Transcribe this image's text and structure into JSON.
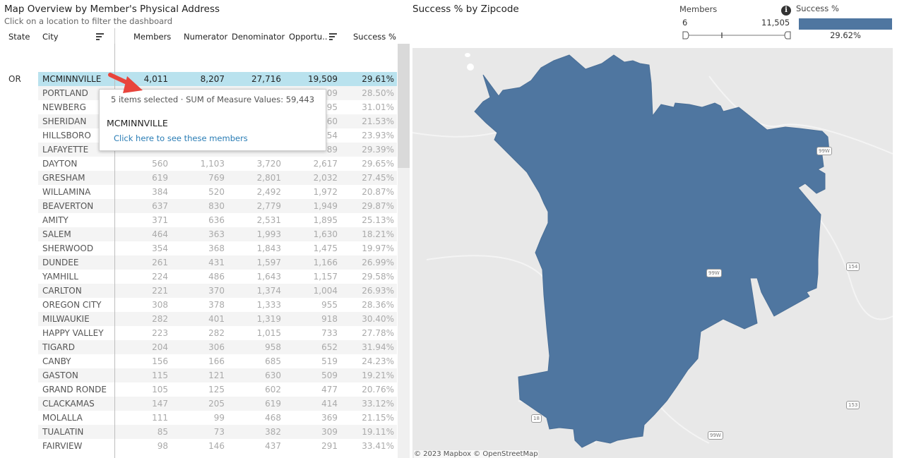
{
  "left": {
    "title": "Map Overview by Member's Physical Address",
    "subtitle": "Click on a location to filter the dashboard"
  },
  "table": {
    "headers": {
      "state": "State",
      "city": "City",
      "members": "Members",
      "numerator": "Numerator",
      "denominator": "Denominator",
      "opportunity": "Opportu..",
      "success": "Success %"
    },
    "state_value": "OR",
    "rows": [
      {
        "city": "MCMINNVILLE",
        "members": "4,011",
        "numerator": "8,207",
        "denominator": "27,716",
        "opportunity": "19,509",
        "success": "29.61%"
      },
      {
        "city": "PORTLAND",
        "members": "",
        "numerator": "",
        "denominator": "",
        "opportunity": "09",
        "success": "28.50%"
      },
      {
        "city": "NEWBERG",
        "members": "",
        "numerator": "",
        "denominator": "",
        "opportunity": "95",
        "success": "31.01%"
      },
      {
        "city": "SHERIDAN",
        "members": "",
        "numerator": "",
        "denominator": "",
        "opportunity": "60",
        "success": "21.53%"
      },
      {
        "city": "HILLSBORO",
        "members": "",
        "numerator": "",
        "denominator": "",
        "opportunity": "54",
        "success": "23.93%"
      },
      {
        "city": "LAFAYETTE",
        "members": "",
        "numerator": "",
        "denominator": "",
        "opportunity": "89",
        "success": "29.39%"
      },
      {
        "city": "DAYTON",
        "members": "560",
        "numerator": "1,103",
        "denominator": "3,720",
        "opportunity": "2,617",
        "success": "29.65%"
      },
      {
        "city": "GRESHAM",
        "members": "619",
        "numerator": "769",
        "denominator": "2,801",
        "opportunity": "2,032",
        "success": "27.45%"
      },
      {
        "city": "WILLAMINA",
        "members": "384",
        "numerator": "520",
        "denominator": "2,492",
        "opportunity": "1,972",
        "success": "20.87%"
      },
      {
        "city": "BEAVERTON",
        "members": "637",
        "numerator": "830",
        "denominator": "2,779",
        "opportunity": "1,949",
        "success": "29.87%"
      },
      {
        "city": "AMITY",
        "members": "371",
        "numerator": "636",
        "denominator": "2,531",
        "opportunity": "1,895",
        "success": "25.13%"
      },
      {
        "city": "SALEM",
        "members": "464",
        "numerator": "363",
        "denominator": "1,993",
        "opportunity": "1,630",
        "success": "18.21%"
      },
      {
        "city": "SHERWOOD",
        "members": "354",
        "numerator": "368",
        "denominator": "1,843",
        "opportunity": "1,475",
        "success": "19.97%"
      },
      {
        "city": "DUNDEE",
        "members": "261",
        "numerator": "431",
        "denominator": "1,597",
        "opportunity": "1,166",
        "success": "26.99%"
      },
      {
        "city": "YAMHILL",
        "members": "224",
        "numerator": "486",
        "denominator": "1,643",
        "opportunity": "1,157",
        "success": "29.58%"
      },
      {
        "city": "CARLTON",
        "members": "221",
        "numerator": "370",
        "denominator": "1,374",
        "opportunity": "1,004",
        "success": "26.93%"
      },
      {
        "city": "OREGON CITY",
        "members": "308",
        "numerator": "378",
        "denominator": "1,333",
        "opportunity": "955",
        "success": "28.36%"
      },
      {
        "city": "MILWAUKIE",
        "members": "282",
        "numerator": "401",
        "denominator": "1,319",
        "opportunity": "918",
        "success": "30.40%"
      },
      {
        "city": "HAPPY VALLEY",
        "members": "223",
        "numerator": "282",
        "denominator": "1,015",
        "opportunity": "733",
        "success": "27.78%"
      },
      {
        "city": "TIGARD",
        "members": "204",
        "numerator": "306",
        "denominator": "958",
        "opportunity": "652",
        "success": "31.94%"
      },
      {
        "city": "CANBY",
        "members": "156",
        "numerator": "166",
        "denominator": "685",
        "opportunity": "519",
        "success": "24.23%"
      },
      {
        "city": "GASTON",
        "members": "115",
        "numerator": "121",
        "denominator": "630",
        "opportunity": "509",
        "success": "19.21%"
      },
      {
        "city": "GRAND RONDE",
        "members": "105",
        "numerator": "125",
        "denominator": "602",
        "opportunity": "477",
        "success": "20.76%"
      },
      {
        "city": "CLACKAMAS",
        "members": "147",
        "numerator": "205",
        "denominator": "619",
        "opportunity": "414",
        "success": "33.12%"
      },
      {
        "city": "MOLALLA",
        "members": "111",
        "numerator": "99",
        "denominator": "468",
        "opportunity": "369",
        "success": "21.15%"
      },
      {
        "city": "TUALATIN",
        "members": "85",
        "numerator": "73",
        "denominator": "382",
        "opportunity": "309",
        "success": "19.11%"
      },
      {
        "city": "FAIRVIEW",
        "members": "98",
        "numerator": "146",
        "denominator": "437",
        "opportunity": "291",
        "success": "33.41%"
      }
    ]
  },
  "tooltip": {
    "header": "5 items selected  ·  SUM of Measure Values: 59,443",
    "city": "MCMINNVILLE",
    "link": "Click here to see these members"
  },
  "map": {
    "title": "Success % by Zipcode",
    "members_filter_label": "Members",
    "members_min": "6",
    "members_max": "11,505",
    "members_range": [
      6,
      11505
    ],
    "legend_label": "Success %",
    "legend_value": "29.62%",
    "region_color": "#4f76a0",
    "info_icon": "info-icon",
    "road_labels": [
      "99W",
      "99W",
      "154",
      "18",
      "153",
      "99W"
    ],
    "copyright": "© 2023 Mapbox © OpenStreetMap"
  }
}
